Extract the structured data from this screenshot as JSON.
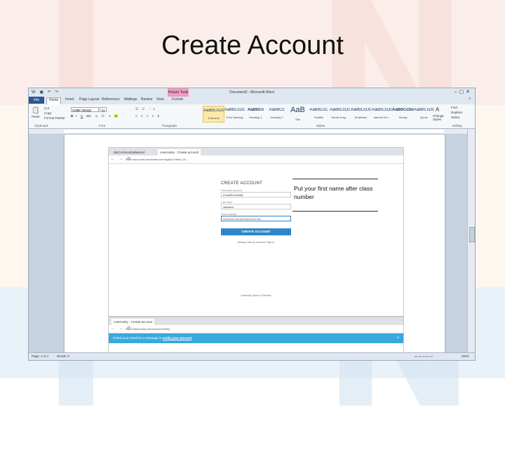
{
  "slide": {
    "title": "Create Account"
  },
  "word": {
    "window_title": "Document2 - Microsoft Word",
    "context_tab_group": "Picture Tools",
    "tabs": [
      "File",
      "Home",
      "Insert",
      "Page Layout",
      "References",
      "Mailings",
      "Review",
      "View",
      "Format"
    ],
    "active_tab": "Home",
    "clipboard": {
      "cut": "Cut",
      "copy": "Copy",
      "paste": "Paste",
      "format_painter": "Format Painter",
      "group_label": "Clipboard"
    },
    "font": {
      "name": "Calibri (Body)",
      "size": "11",
      "group_label": "Font"
    },
    "paragraph_group_label": "Paragraph",
    "styles_group_label": "Styles",
    "editing_group_label": "Editing",
    "styles": [
      {
        "sample": "AaBbCcDc",
        "name": "¶ Normal"
      },
      {
        "sample": "AaBbCcDc",
        "name": "¶ No Spacing"
      },
      {
        "sample": "AaBbCc",
        "name": "Heading 1"
      },
      {
        "sample": "AaBbCc",
        "name": "Heading 2"
      },
      {
        "sample": "AaB",
        "name": "Title"
      },
      {
        "sample": "AaBbCcC",
        "name": "Subtitle"
      },
      {
        "sample": "AaBbCcDc",
        "name": "Subtle Emp..."
      },
      {
        "sample": "AaBbCcDc",
        "name": "Emphasis"
      },
      {
        "sample": "AaBbCcDc",
        "name": "Intense Em..."
      },
      {
        "sample": "AaBbCcDc",
        "name": "Strong"
      },
      {
        "sample": "AaBbCcDc",
        "name": "Quote"
      }
    ],
    "change_styles": "Change Styles",
    "find": "Find",
    "replace": "Replace",
    "select": "Select",
    "status": {
      "page": "Page: 1 of 1",
      "words": "Words: 0",
      "zoom": "100%"
    }
  },
  "browser1": {
    "tabs": [
      "MyCommunityBeyond",
      "Learnosity - Create account"
    ],
    "url": "https://accounts.learnosity.com/signup?client_id=...",
    "form": {
      "heading": "CREATE ACCOUNT",
      "first_label": "First name (shown)",
      "first_value": "EXAMPLENAME",
      "last_label": "Last name",
      "last_value": "lastname",
      "email_label": "Email address",
      "email_value": "firstname.lastname@school.edu",
      "submit": "CREATE ACCOUNT",
      "signin": "Already have an account? Sign in"
    },
    "footer": "Learnosity Terms of Service"
  },
  "callout": {
    "text": "Put your first name after class number"
  },
  "browser2": {
    "tab": "Learnosity - Create account",
    "url": "https://learnosity.com/account/verify",
    "banner_text": "Check your email for a message to",
    "banner_link": "verify your account",
    "close": "×"
  },
  "colors": {
    "accent": "#2e86c8",
    "banner": "#39a9dc",
    "word_file_tab": "#2b5797",
    "context_tab": "#e8a0c0"
  }
}
